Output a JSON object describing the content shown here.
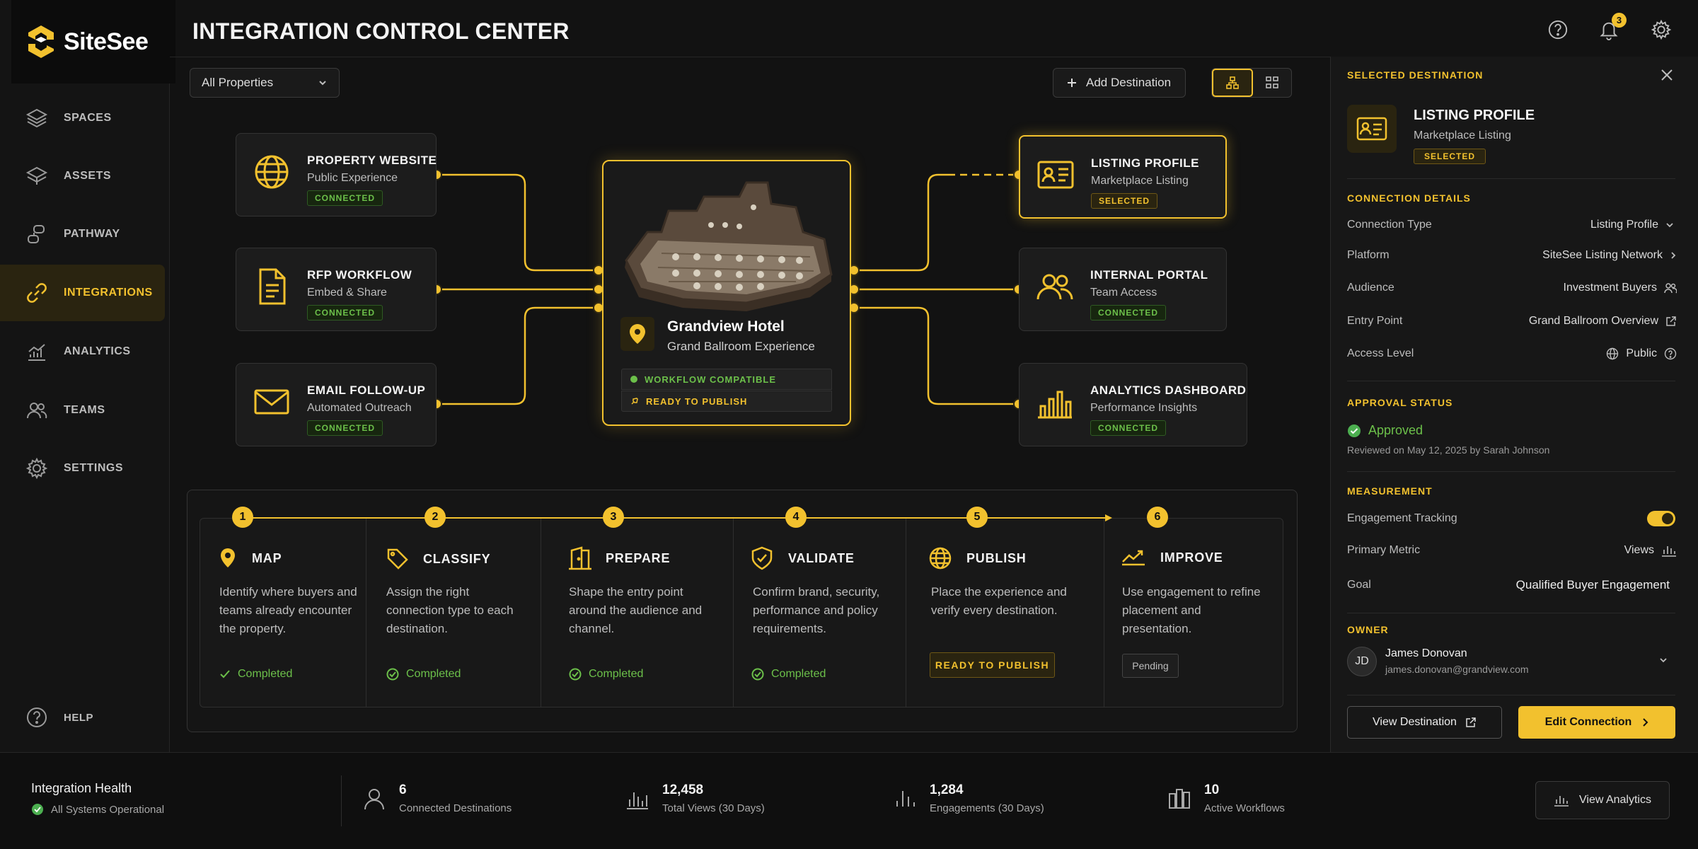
{
  "app": {
    "brand": "SiteSee",
    "title": "INTEGRATION CONTROL CENTER",
    "notifications": "3"
  },
  "sidebar": {
    "items": [
      {
        "label": "SPACES",
        "icon": "layers-icon"
      },
      {
        "label": "ASSETS",
        "icon": "stack-icon"
      },
      {
        "label": "PATHWAY",
        "icon": "pathway-icon"
      },
      {
        "label": "INTEGRATIONS",
        "icon": "link-icon",
        "active": true
      },
      {
        "label": "ANALYTICS",
        "icon": "chart-icon"
      },
      {
        "label": "TEAMS",
        "icon": "people-icon"
      },
      {
        "label": "SETTINGS",
        "icon": "gear-icon"
      }
    ],
    "help": "HELP"
  },
  "toolbar": {
    "property_select": "All Properties",
    "add_destination": "Add Destination"
  },
  "sources": [
    {
      "title": "PROPERTY WEBSITE",
      "sub": "Public Experience",
      "badge": "CONNECTED"
    },
    {
      "title": "RFP WORKFLOW",
      "sub": "Embed & Share",
      "badge": "CONNECTED"
    },
    {
      "title": "EMAIL FOLLOW-UP",
      "sub": "Automated Outreach",
      "badge": "CONNECTED"
    }
  ],
  "center": {
    "name": "Grandview Hotel",
    "sub": "Grand Ballroom Experience",
    "status1": "WORKFLOW COMPATIBLE",
    "status2": "READY TO PUBLISH"
  },
  "destinations": [
    {
      "title": "LISTING PROFILE",
      "sub": "Marketplace Listing",
      "badge": "SELECTED"
    },
    {
      "title": "INTERNAL PORTAL",
      "sub": "Team Access",
      "badge": "CONNECTED"
    },
    {
      "title": "ANALYTICS DASHBOARD",
      "sub": "Performance Insights",
      "badge": "CONNECTED"
    }
  ],
  "steps": [
    {
      "num": "1",
      "title": "MAP",
      "desc": "Identify where buyers and teams already encounter the property.",
      "status": "Completed"
    },
    {
      "num": "2",
      "title": "CLASSIFY",
      "desc": "Assign the right connection type to each destination.",
      "status": "Completed"
    },
    {
      "num": "3",
      "title": "PREPARE",
      "desc": "Shape the entry point around the audience and channel.",
      "status": "Completed"
    },
    {
      "num": "4",
      "title": "VALIDATE",
      "desc": "Confirm brand, security, performance and policy requirements.",
      "status": "Completed"
    },
    {
      "num": "5",
      "title": "PUBLISH",
      "desc": "Place the experience and verify every destination.",
      "status": "READY TO PUBLISH"
    },
    {
      "num": "6",
      "title": "IMPROVE",
      "desc": "Use engagement to refine placement and presentation.",
      "status": "Pending"
    }
  ],
  "panel": {
    "header": "SELECTED DESTINATION",
    "title": "LISTING PROFILE",
    "sub": "Marketplace Listing",
    "badge": "SELECTED",
    "connection_header": "CONNECTION DETAILS",
    "rows": [
      {
        "label": "Connection Type",
        "value": "Listing Profile"
      },
      {
        "label": "Platform",
        "value": "SiteSee Listing Network"
      },
      {
        "label": "Audience",
        "value": "Investment Buyers"
      },
      {
        "label": "Entry Point",
        "value": "Grand Ballroom Overview"
      },
      {
        "label": "Access Level",
        "value": "Public"
      }
    ],
    "approval_header": "APPROVAL STATUS",
    "approval_status": "Approved",
    "approval_note": "Reviewed on May 12, 2025 by Sarah Johnson",
    "measurement_header": "MEASUREMENT",
    "engagement_label": "Engagement Tracking",
    "engagement_on": true,
    "metric_label": "Primary Metric",
    "metric_value": "Views",
    "goal_label": "Goal",
    "goal_value": "Qualified Buyer Engagement",
    "owner_header": "OWNER",
    "owner_initials": "JD",
    "owner_name": "James Donovan",
    "owner_email": "james.donovan@grandview.com",
    "view_btn": "View Destination",
    "edit_btn": "Edit Connection"
  },
  "footer": {
    "health_title": "Integration Health",
    "health_status": "All Systems Operational",
    "stats": [
      {
        "value": "6",
        "label": "Connected Destinations"
      },
      {
        "value": "12,458",
        "label": "Total Views (30 Days)"
      },
      {
        "value": "1,284",
        "label": "Engagements (30 Days)"
      },
      {
        "value": "10",
        "label": "Active Workflows"
      }
    ],
    "view_analytics": "View Analytics"
  },
  "colors": {
    "accent": "#f2c12e",
    "success": "#6cc04a",
    "bg": "#121212"
  }
}
